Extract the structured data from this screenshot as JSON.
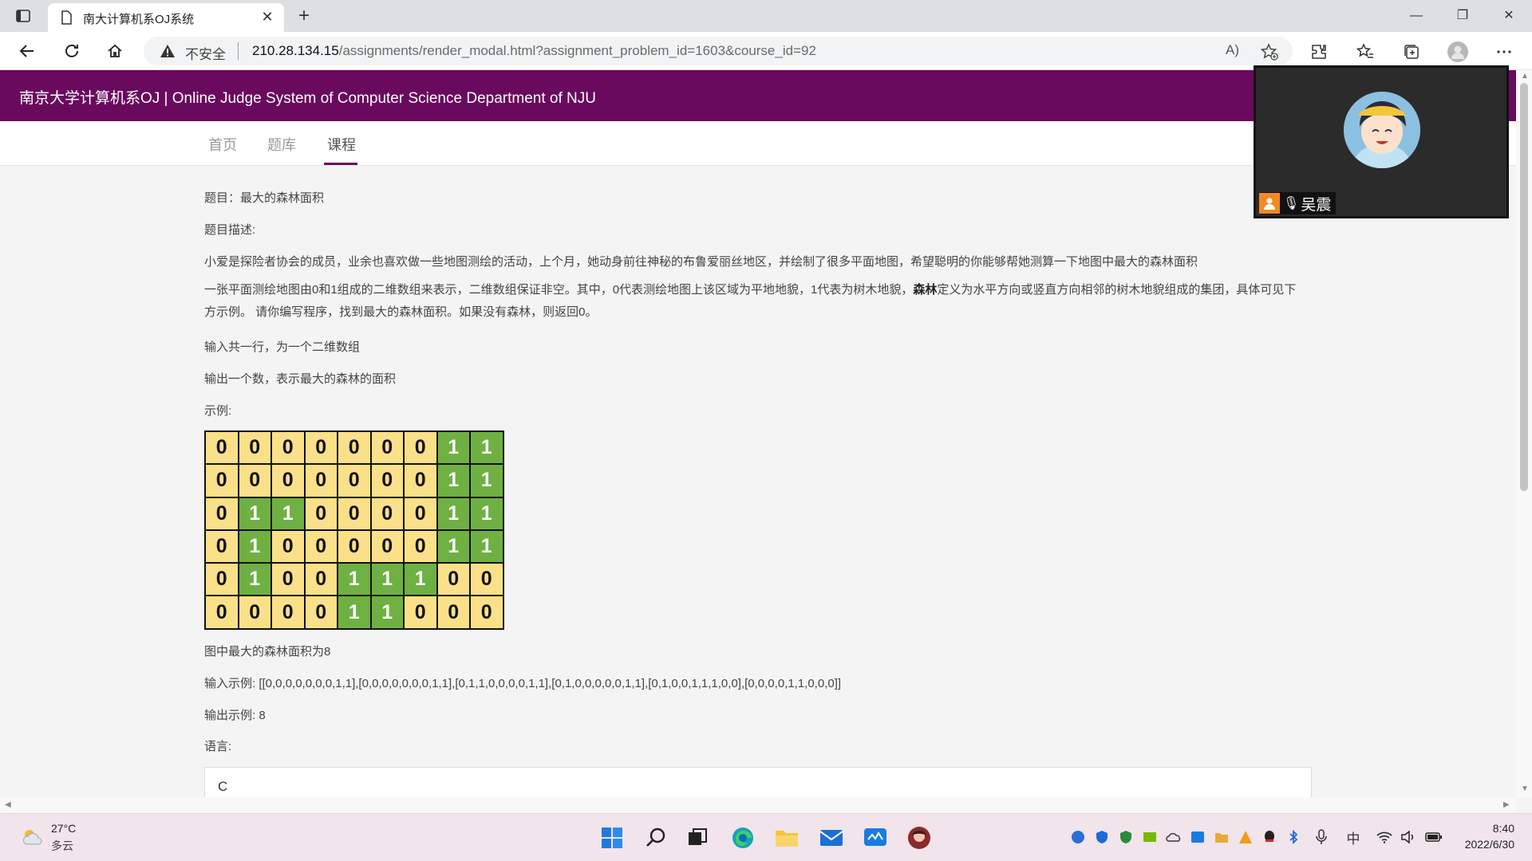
{
  "browser": {
    "tab_title": "南大计算机系OJ系统",
    "tab_close": "✕",
    "new_tab": "+",
    "insecure_label": "不安全",
    "url_host": "210.28.134.15",
    "url_rest": "/assignments/render_modal.html?assignment_problem_id=1603&course_id=92",
    "read_aloud": "A)"
  },
  "site": {
    "title": "南京大学计算机系OJ | Online Judge System of Computer Science Department of NJU",
    "nav": [
      {
        "label": "首页",
        "active": false
      },
      {
        "label": "题库",
        "active": false
      },
      {
        "label": "课程",
        "active": true
      }
    ]
  },
  "problem": {
    "title_line": "题目：最大的森林面积",
    "desc_label": "题目描述:",
    "intro": "小爱是探险者协会的成员，业余也喜欢做一些地图测绘的活动，上个月，她动身前往神秘的布鲁爱丽丝地区，并绘制了很多平面地图，希望聪明的你能够帮她测算一下地图中最大的森林面积",
    "def_before": "一张平面测绘地图由0和1组成的二维数组来表示，二维数组保证非空。其中，0代表测绘地图上该区域为平地地貌，1代表为树木地貌，",
    "def_bold": "森林",
    "def_after": "定义为水平方向或竖直方向相邻的树木地貌组成的集团，具体可见下方示例。 请你编写程序，找到最大的森林面积。如果没有森林，则返回0。",
    "input_desc": "输入共一行，为一个二维数组",
    "output_desc": "输出一个数，表示最大的森林的面积",
    "example_label": "示例:",
    "grid": [
      [
        0,
        0,
        0,
        0,
        0,
        0,
        0,
        1,
        1
      ],
      [
        0,
        0,
        0,
        0,
        0,
        0,
        0,
        1,
        1
      ],
      [
        0,
        1,
        1,
        0,
        0,
        0,
        0,
        1,
        1
      ],
      [
        0,
        1,
        0,
        0,
        0,
        0,
        0,
        1,
        1
      ],
      [
        0,
        1,
        0,
        0,
        1,
        1,
        1,
        0,
        0
      ],
      [
        0,
        0,
        0,
        0,
        1,
        1,
        0,
        0,
        0
      ]
    ],
    "caption": "图中最大的森林面积为8",
    "input_example": "输入示例: [[0,0,0,0,0,0,0,1,1],[0,0,0,0,0,0,0,1,1],[0,1,1,0,0,0,0,1,1],[0,1,0,0,0,0,0,1,1],[0,1,0,0,1,1,1,0,0],[0,0,0,0,1,1,0,0,0]]",
    "output_example": "输出示例: 8",
    "language_label": "语言:",
    "language_value": "C"
  },
  "video": {
    "participant_name": "吴震"
  },
  "taskbar": {
    "temperature": "27°C",
    "condition": "多云",
    "ime": "中",
    "time": "8:40",
    "date": "2022/6/30"
  },
  "colors": {
    "header": "#690a5e",
    "land": "#fbe08a",
    "forest": "#6fb043"
  }
}
